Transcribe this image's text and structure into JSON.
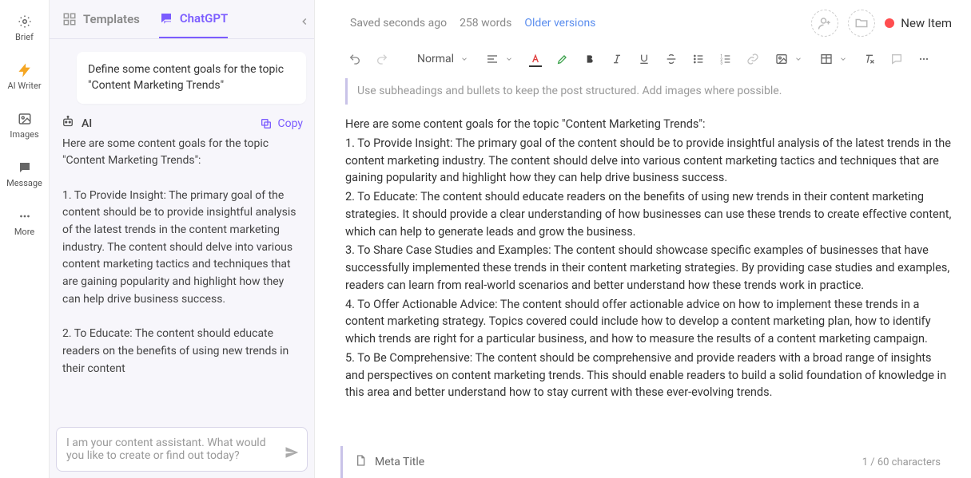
{
  "rail": {
    "items": [
      {
        "label": "Brief"
      },
      {
        "label": "AI Writer"
      },
      {
        "label": "Images"
      },
      {
        "label": "Message"
      },
      {
        "label": "More"
      }
    ]
  },
  "tabs": {
    "templates": "Templates",
    "chatgpt": "ChatGPT"
  },
  "chat": {
    "user_msg": "Define some content goals for the topic \"Content Marketing Trends\"",
    "ai_label": "AI",
    "copy_label": "Copy",
    "ai_msg": "Here are some content goals for the topic \"Content Marketing Trends\":\n\n1. To Provide Insight: The primary goal of the content should be to provide insightful analysis of the latest trends in the content marketing industry. The content should delve into various content marketing tactics and techniques that are gaining popularity and highlight how they can help drive business success.\n\n2. To Educate: The content should educate readers on the benefits of using new trends in their content",
    "input_placeholder": "I am your content assistant. What would you like to create or find out today?"
  },
  "topbar": {
    "saved": "Saved seconds ago",
    "words": "258 words",
    "older": "Older versions",
    "new_item": "New Item"
  },
  "toolbar": {
    "style_label": "Normal"
  },
  "doc": {
    "hint": "Use subheadings and bullets to keep the post structured. Add images where possible.",
    "p0": "Here are some content goals for the topic \"Content Marketing Trends\":",
    "p1": "1. To Provide Insight: The primary goal of the content should be to provide insightful analysis of the latest trends in the content marketing industry. The content should delve into various content marketing tactics and techniques that are gaining popularity and highlight how they can help drive business success.",
    "p2": "2. To Educate: The content should educate readers on the benefits of using new trends in their content marketing strategies. It should provide a clear understanding of how businesses can use these trends to create effective content, which can help to generate leads and grow the business.",
    "p3": "3. To Share Case Studies and Examples: The content should showcase specific examples of businesses that have successfully implemented these trends in their content marketing strategies. By providing case studies and examples, readers can learn from real-world scenarios and better understand how these trends work in practice.",
    "p4": "4. To Offer Actionable Advice: The content should offer actionable advice on how to implement these trends in a content marketing strategy. Topics covered could include how to develop a content marketing plan, how to identify which trends are right for a particular business, and how to measure the results of a content marketing campaign.",
    "p5": "5. To Be Comprehensive: The content should be comprehensive and provide readers with a broad range of insights and perspectives on content marketing trends. This should enable readers to build a solid foundation of knowledge in this area and better understand how to stay current with these ever-evolving trends."
  },
  "meta": {
    "title_label": "Meta Title",
    "chars": "1 / 60 characters"
  }
}
